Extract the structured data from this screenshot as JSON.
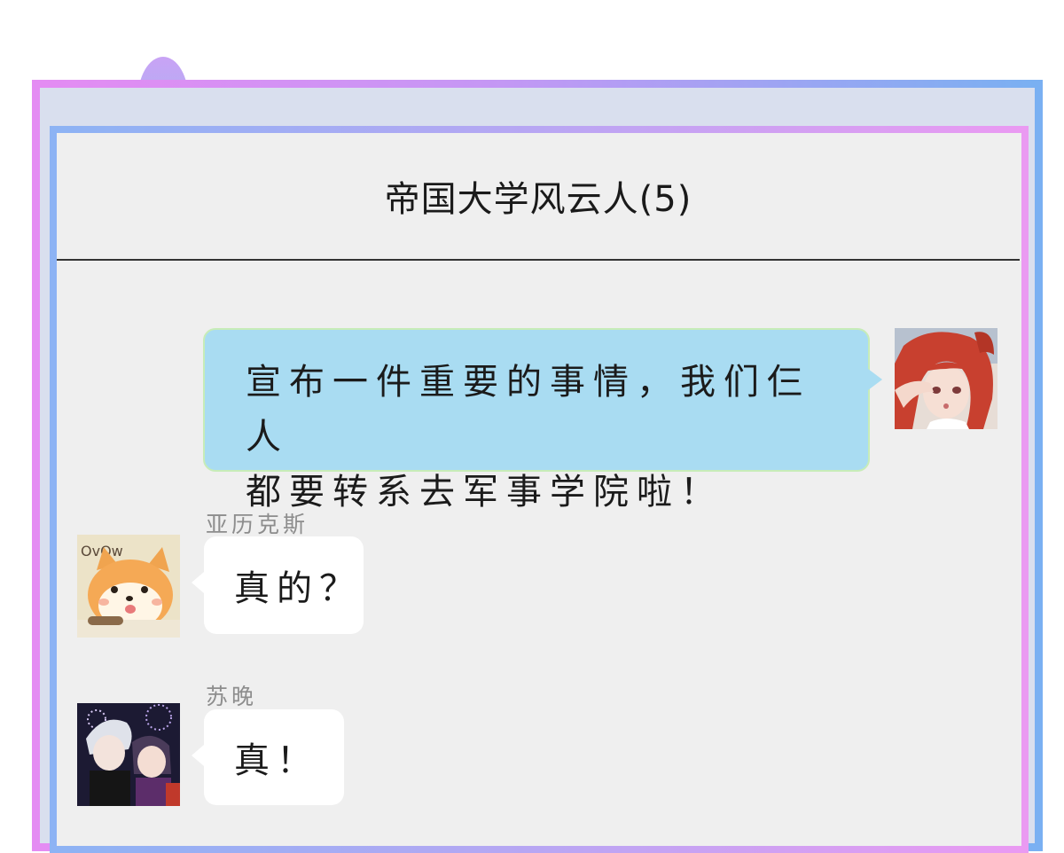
{
  "chat": {
    "title": "帝国大学风云人(5)"
  },
  "messages": [
    {
      "side": "right",
      "sender": "",
      "avatar": "red-haired-girl-avatar",
      "line1": "宣布一件重要的事情，我们仨人",
      "line2": "都要转系去军事学院啦！"
    },
    {
      "side": "left",
      "sender": "亚历克斯",
      "avatar": "shiba-dog-avatar",
      "text": "真的？"
    },
    {
      "side": "left",
      "sender": "苏晚",
      "avatar": "couple-fireworks-avatar",
      "text": "真！"
    }
  ],
  "colors": {
    "self_bubble": "#a9dcf2",
    "other_bubble": "#ffffff",
    "chat_bg": "#efefef"
  }
}
